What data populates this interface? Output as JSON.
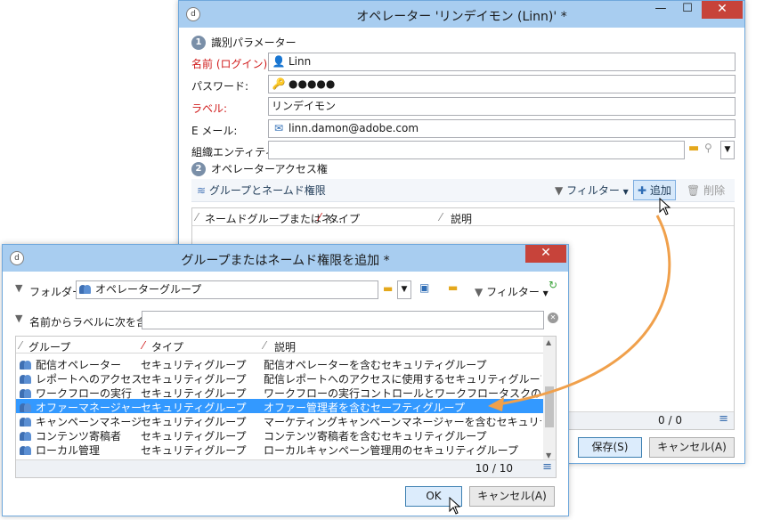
{
  "operator_window": {
    "title": "オペレーター 'リンデイモン (Linn)' *",
    "minimize": "—",
    "maximize": "☐",
    "close": "✕",
    "section1": {
      "num": "1",
      "label": "識別パラメーター"
    },
    "fields": {
      "login_label": "名前 (ログイン):",
      "login_value": "Linn",
      "password_label": "パスワード:",
      "password_value": "●●●●●",
      "label_label": "ラベル:",
      "label_value": "リンデイモン",
      "email_label": "E メール:",
      "email_value": "linn.damon@adobe.com",
      "org_label": "組織エンティティ:",
      "org_value": ""
    },
    "section2": {
      "num": "2",
      "label": "オペレーターアクセス権"
    },
    "toolbar": {
      "groups_link": "グループとネームド権限",
      "filter": "フィルター",
      "add": "追加",
      "delete": "削除"
    },
    "grid": {
      "col1": "ネームドグループまたはネ...",
      "col2": "タイプ",
      "col3": "説明",
      "count": "0 / 0"
    },
    "save_button": "保存(S)",
    "cancel_button": "キャンセル(A)"
  },
  "dialog": {
    "title": "グループまたはネームド権限を追加 *",
    "close": "✕",
    "folder_label": "フォルダー:",
    "folder_value": "オペレーターグループ",
    "filter_label": "フィルター",
    "search_label": "名前からラベルに次を含む:",
    "search_value": "",
    "columns": {
      "group": "グループ",
      "type": "タイプ",
      "desc": "説明"
    },
    "rows": [
      {
        "group": "配信オペレーター",
        "type": "セキュリティグループ",
        "desc": "配信オペレーターを含むセキュリティグループ"
      },
      {
        "group": "レポートへのアクセス",
        "type": "セキュリティグループ",
        "desc": "配信レポートへのアクセスに使用するセキュリティグループ (Web アク"
      },
      {
        "group": "ワークフローの実行",
        "type": "セキュリティグループ",
        "desc": "ワークフローの実行コントロールとワークフロータスクの承認を有効..."
      },
      {
        "group": "オファーマネージャー",
        "type": "セキュリティグループ",
        "desc": "オファー管理者を含むセーフティグループ"
      },
      {
        "group": "キャンペーンマネージャー",
        "type": "セキュリティグループ",
        "desc": "マーケティングキャンペーンマネージャーを含むセキュリティグループ"
      },
      {
        "group": "コンテンツ寄稿者",
        "type": "セキュリティグループ",
        "desc": "コンテンツ寄稿者を含むセキュリティグループ"
      },
      {
        "group": "ローカル管理",
        "type": "セキュリティグループ",
        "desc": "ローカルキャンペーン管理用のセキュリティグループ"
      }
    ],
    "selected_row": 3,
    "count": "10 / 10",
    "ok_button": "OK",
    "cancel_button": "キャンセル(A)"
  },
  "colors": {
    "titlebar": "#a8cdf0",
    "close": "#c7433a",
    "selection": "#3399ff",
    "arrow": "#f0a04b"
  }
}
